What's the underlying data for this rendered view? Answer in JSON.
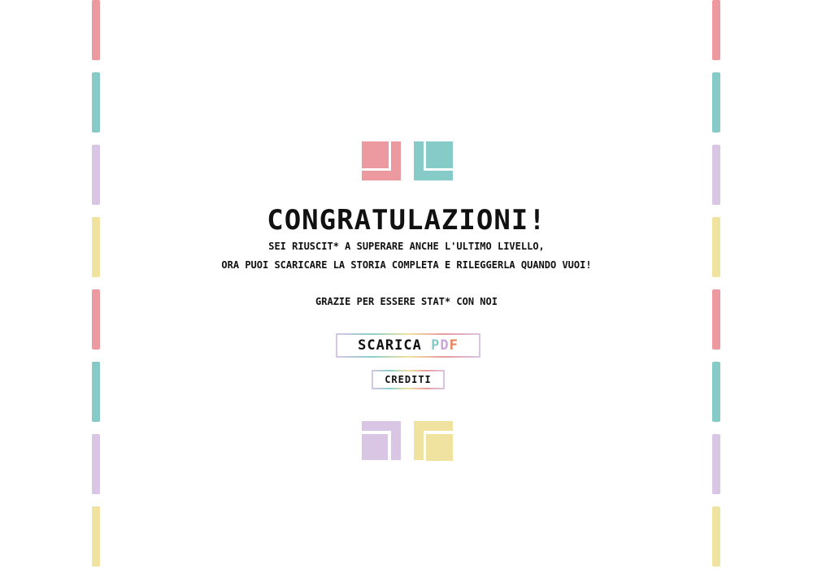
{
  "colors": {
    "pink": "#ec9aa0",
    "teal": "#86cbc8",
    "lavender": "#d8c6e4",
    "yellow": "#f0e3a0",
    "text": "#111111"
  },
  "side_stripes": {
    "left": [
      "pink",
      "teal",
      "lavender",
      "yellow",
      "pink",
      "teal",
      "lavender",
      "yellow"
    ],
    "right": [
      "pink",
      "teal",
      "lavender",
      "yellow",
      "pink",
      "teal",
      "lavender",
      "yellow"
    ]
  },
  "heading": {
    "title": "Congratulazioni!",
    "line1": "Sei riuscit* a superare anche l'ultimo livello,",
    "line2": "ora puoi scaricare la storia completa e rileggerla quando vuoi!",
    "line3": "Grazie per essere stat* con noi"
  },
  "actions": {
    "download_label": "Scarica",
    "download_format": "PDF",
    "download_format_letters": [
      {
        "char": "P",
        "color": "#86cbc8"
      },
      {
        "char": "D",
        "color": "#c9a8d8"
      },
      {
        "char": "F",
        "color": "#e6855a"
      }
    ],
    "credits_label": "Crediti"
  }
}
